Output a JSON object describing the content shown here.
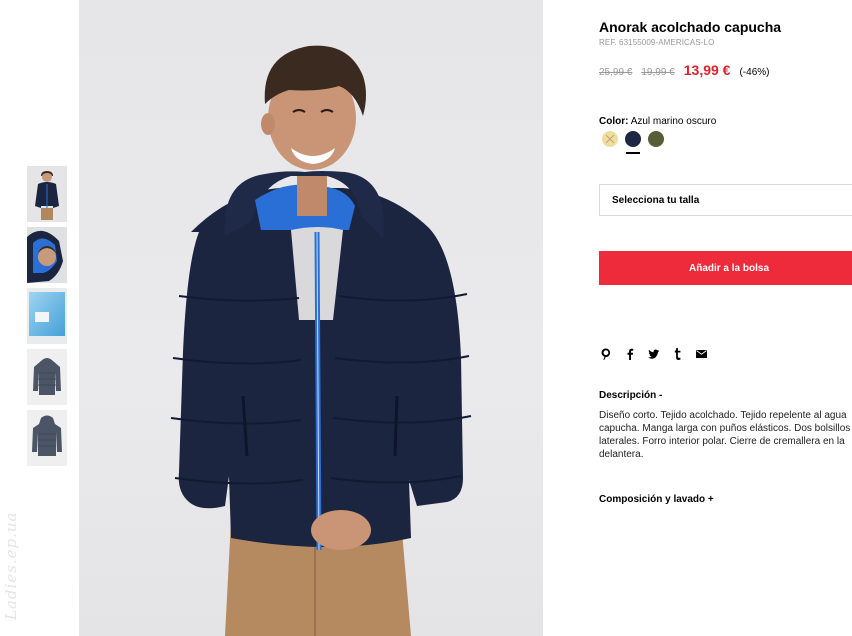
{
  "watermark": "Ladies.ep.ua",
  "gallery": {
    "thumbnails": [
      {
        "name": "thumb-front"
      },
      {
        "name": "thumb-hood-closeup"
      },
      {
        "name": "thumb-packaging"
      },
      {
        "name": "thumb-jacket-front"
      },
      {
        "name": "thumb-jacket-back"
      }
    ]
  },
  "product": {
    "title": "Anorak acolchado capucha",
    "ref": "REF. 63155009-AMERICAS-LO",
    "prices": {
      "original": "25,99 €",
      "previous": "19,99 €",
      "current": "13,99 €",
      "discount": "(-46%)"
    },
    "color_label": "Color:",
    "color_value": "Azul marino oscuro",
    "swatches": [
      {
        "name": "swatch-unavailable-yellow",
        "color": "#f2dda0"
      },
      {
        "name": "swatch-navy",
        "color": "#1d2742",
        "selected": true
      },
      {
        "name": "swatch-khaki",
        "color": "#575e35"
      }
    ],
    "size_placeholder": "Selecciona tu talla",
    "add_to_bag": "Añadir a la bolsa",
    "share_icons": [
      "pinterest-icon",
      "facebook-icon",
      "twitter-icon",
      "tumblr-icon",
      "mail-icon"
    ],
    "description_heading": "Descripción  -",
    "description_lines": [
      "Diseño corto. Tejido acolchado. Tejido repelente al agua",
      "capucha. Manga larga con puños elásticos. Dos bolsillos",
      "laterales. Forro interior polar. Cierre de cremallera en la",
      "delantera."
    ],
    "composition_heading": "Composición y lavado  +"
  },
  "colors": {
    "accent_red": "#ee2b3b",
    "price_red": "#e0202b",
    "jacket_navy": "#1b2540",
    "zip_blue": "#2a6fd6"
  }
}
